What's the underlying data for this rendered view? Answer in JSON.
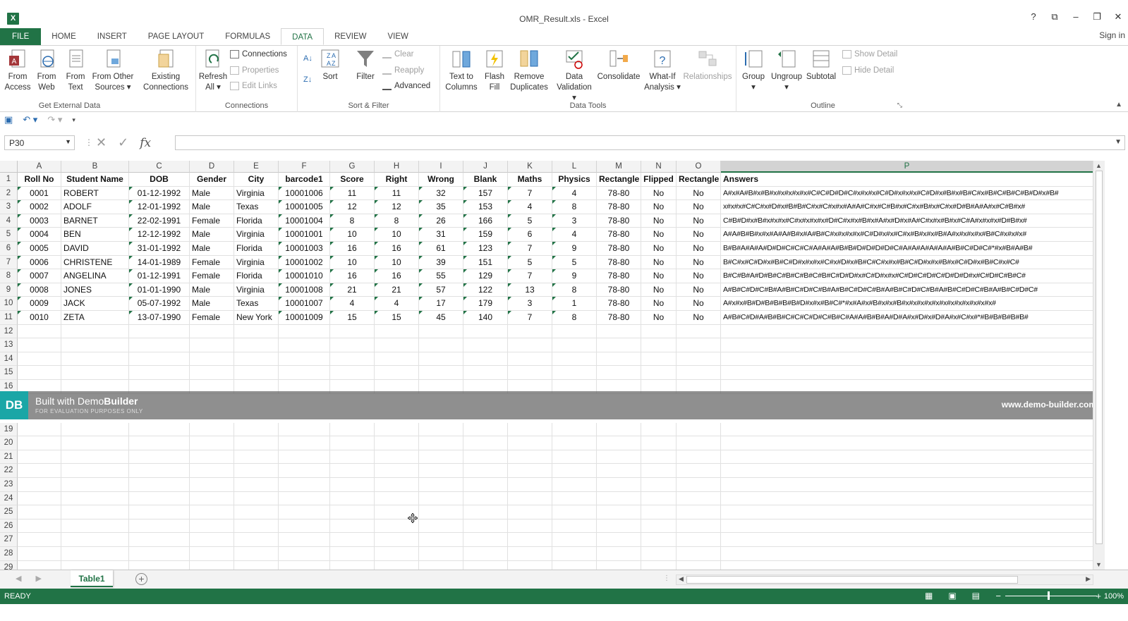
{
  "window": {
    "title": "OMR_Result.xls - Excel",
    "signin": "Sign in",
    "controls": [
      "?",
      "⧉",
      "–",
      "❐",
      "✕"
    ]
  },
  "tabs": [
    "FILE",
    "HOME",
    "INSERT",
    "PAGE LAYOUT",
    "FORMULAS",
    "DATA",
    "REVIEW",
    "VIEW"
  ],
  "ribbon": {
    "get_external": {
      "label": "Get External Data",
      "buttons": [
        "From\nAccess",
        "From\nWeb",
        "From\nText",
        "From Other\nSources ▾"
      ],
      "existing": "Existing\nConnections"
    },
    "connections": {
      "label": "Connections",
      "refresh": "Refresh\nAll ▾",
      "items": [
        "Connections",
        "Properties",
        "Edit Links"
      ]
    },
    "sort_filter": {
      "label": "Sort & Filter",
      "sort": "Sort",
      "filter": "Filter",
      "items": [
        "Clear",
        "Reapply",
        "Advanced"
      ]
    },
    "data_tools": {
      "label": "Data Tools",
      "buttons": [
        "Text to\nColumns",
        "Flash\nFill",
        "Remove\nDuplicates",
        "Data\nValidation ▾",
        "Consolidate",
        "What-If\nAnalysis ▾",
        "Relationships"
      ]
    },
    "outline": {
      "label": "Outline",
      "buttons": [
        "Group\n▾",
        "Ungroup\n▾",
        "Subtotal"
      ],
      "items": [
        "Show Detail",
        "Hide Detail"
      ]
    }
  },
  "formula_bar": {
    "namebox": "P30",
    "formula": ""
  },
  "columns": [
    "A",
    "B",
    "C",
    "D",
    "E",
    "F",
    "G",
    "H",
    "I",
    "J",
    "K",
    "L",
    "M",
    "N",
    "O",
    "P"
  ],
  "table": {
    "headers": [
      "Roll No",
      "Student Name",
      "DOB",
      "Gender",
      "City",
      "barcode1",
      "Score",
      "Right",
      "Wrong",
      "Blank",
      "Maths",
      "Physics",
      "Rectangle",
      "Flipped",
      "Rectangle",
      "Answers"
    ],
    "rows": [
      [
        "0001",
        "ROBERT",
        "01-12-1992",
        "Male",
        "Virginia",
        "10001006",
        "11",
        "11",
        "32",
        "157",
        "7",
        "4",
        "78-80",
        "No",
        "No",
        "A#x#A#B#x#B#x#x#x#x#x#C#C#D#D#C#x#x#x#C#D#x#x#x#C#D#x#B#x#B#C#x#B#C#B#C#B#D#x#B#"
      ],
      [
        "0002",
        "ADOLF",
        "12-01-1992",
        "Male",
        "Texas",
        "10001005",
        "12",
        "12",
        "35",
        "153",
        "4",
        "8",
        "78-80",
        "No",
        "No",
        "x#x#x#C#C#x#D#x#B#B#C#x#C#x#x#A#A#C#x#C#B#x#C#x#B#x#C#x#D#B#A#A#x#C#B#x#"
      ],
      [
        "0003",
        "BARNET",
        "22-02-1991",
        "Female",
        "Florida",
        "10001004",
        "8",
        "8",
        "26",
        "166",
        "5",
        "3",
        "78-80",
        "No",
        "No",
        "C#B#D#x#B#x#x#x#C#x#x#x#x#D#C#x#x#B#x#A#x#D#x#A#C#x#x#B#x#C#A#x#x#x#D#B#x#"
      ],
      [
        "0004",
        "BEN",
        "12-12-1992",
        "Male",
        "Virginia",
        "10001001",
        "10",
        "10",
        "31",
        "159",
        "6",
        "4",
        "78-80",
        "No",
        "No",
        "A#A#B#B#x#x#A#A#B#x#A#B#C#x#x#x#x#C#D#x#x#C#x#B#x#x#B#A#x#x#x#x#B#C#x#x#x#"
      ],
      [
        "0005",
        "DAVID",
        "31-01-1992",
        "Male",
        "Florida",
        "10001003",
        "16",
        "16",
        "61",
        "123",
        "7",
        "9",
        "78-80",
        "No",
        "No",
        "B#B#A#A#A#D#D#C#C#C#A#A#A#B#B#D#D#D#D#C#A#A#A#A#A#A#B#C#D#C#*#x#B#A#B#"
      ],
      [
        "0006",
        "CHRISTENE",
        "14-01-1989",
        "Female",
        "Virginia",
        "10001002",
        "10",
        "10",
        "39",
        "151",
        "5",
        "5",
        "78-80",
        "No",
        "No",
        "B#C#x#C#D#x#B#C#D#x#x#x#C#x#D#x#B#C#C#x#x#B#C#D#x#x#B#x#C#D#x#B#C#x#C#"
      ],
      [
        "0007",
        "ANGELINA",
        "01-12-1991",
        "Female",
        "Florida",
        "10001010",
        "16",
        "16",
        "55",
        "129",
        "7",
        "9",
        "78-80",
        "No",
        "No",
        "B#C#B#A#D#B#C#B#C#B#C#B#C#D#D#x#C#D#x#x#C#D#C#D#C#D#D#D#x#C#D#C#B#C#"
      ],
      [
        "0008",
        "JONES",
        "01-01-1990",
        "Male",
        "Virginia",
        "10001008",
        "21",
        "21",
        "57",
        "122",
        "13",
        "8",
        "78-80",
        "No",
        "No",
        "A#B#C#D#C#B#A#B#C#D#C#B#A#B#C#D#C#B#A#B#C#D#C#B#A#B#C#D#C#B#A#B#C#D#C#"
      ],
      [
        "0009",
        "JACK",
        "05-07-1992",
        "Male",
        "Texas",
        "10001007",
        "4",
        "4",
        "17",
        "179",
        "3",
        "1",
        "78-80",
        "No",
        "No",
        "A#x#x#B#D#B#B#B#B#D#x#x#B#C#*#x#A#x#B#x#x#B#x#x#x#x#x#x#x#x#x#x#x#x#"
      ],
      [
        "0010",
        "ZETA",
        "13-07-1990",
        "Female",
        "New York",
        "10001009",
        "15",
        "15",
        "45",
        "140",
        "7",
        "8",
        "78-80",
        "No",
        "No",
        "A#B#C#D#A#B#B#C#C#C#D#C#B#C#A#A#B#B#A#D#A#x#D#x#D#A#x#C#x#*#B#B#B#B#B#"
      ]
    ]
  },
  "row_numbers": [
    "1",
    "2",
    "3",
    "4",
    "5",
    "6",
    "7",
    "8",
    "9",
    "10",
    "11",
    "12",
    "13",
    "14",
    "15",
    "16",
    "19",
    "20",
    "21",
    "22",
    "23",
    "24",
    "25",
    "26",
    "27",
    "28",
    "29"
  ],
  "watermark": {
    "logo": "DB",
    "title_pre": "Built with Demo",
    "title_bold": "Builder",
    "sub": "FOR EVALUATION PURPOSES ONLY",
    "url": "www.demo-builder.com"
  },
  "sheet": {
    "tab": "Table1",
    "add": "+"
  },
  "status": {
    "ready": "READY",
    "zoom": "100%"
  },
  "colors": {
    "accent": "#217346",
    "watermark_logo": "#1aa6a6"
  }
}
